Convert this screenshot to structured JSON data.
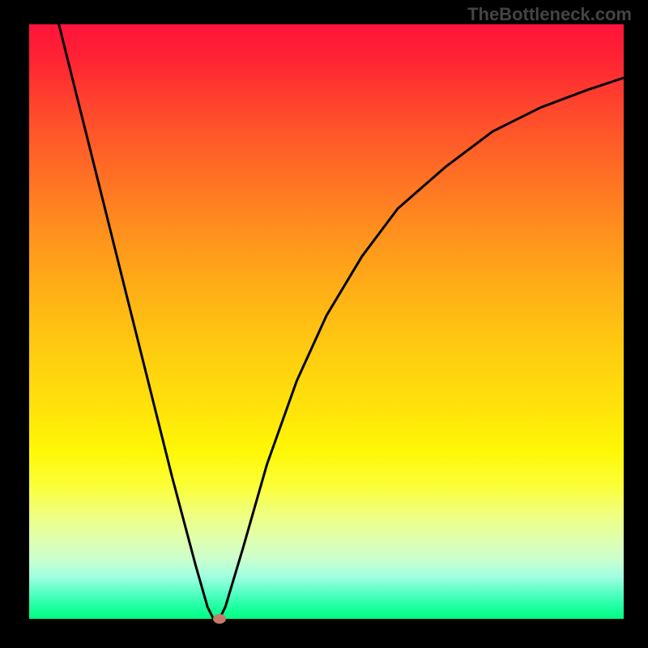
{
  "watermark": "TheBottleneck.com",
  "chart_data": {
    "type": "line",
    "title": "",
    "xlabel": "",
    "ylabel": "",
    "x_range": [
      0,
      100
    ],
    "y_range": [
      0,
      100
    ],
    "background_gradient": {
      "top": "#ff143c",
      "bottom": "#00ff80",
      "description": "red-orange-yellow-green vertical gradient; red=high bottleneck, green=low"
    },
    "curve_points": [
      {
        "x": 5,
        "y": 100
      },
      {
        "x": 8,
        "y": 88
      },
      {
        "x": 12,
        "y": 72
      },
      {
        "x": 16,
        "y": 56
      },
      {
        "x": 20,
        "y": 40
      },
      {
        "x": 24,
        "y": 24
      },
      {
        "x": 28,
        "y": 9
      },
      {
        "x": 30,
        "y": 2
      },
      {
        "x": 31,
        "y": 0
      },
      {
        "x": 32,
        "y": 0
      },
      {
        "x": 33,
        "y": 2
      },
      {
        "x": 36,
        "y": 12
      },
      {
        "x": 40,
        "y": 26
      },
      {
        "x": 45,
        "y": 40
      },
      {
        "x": 50,
        "y": 51
      },
      {
        "x": 56,
        "y": 61
      },
      {
        "x": 62,
        "y": 69
      },
      {
        "x": 70,
        "y": 76
      },
      {
        "x": 78,
        "y": 82
      },
      {
        "x": 86,
        "y": 86
      },
      {
        "x": 94,
        "y": 89
      },
      {
        "x": 100,
        "y": 91
      }
    ],
    "marker": {
      "x": 32,
      "y": 0,
      "color": "#c47a6a"
    },
    "optimum_x": 31.5,
    "note": "V-shaped bottleneck curve; minimum near x≈31.5 where bottleneck approaches 0%"
  }
}
